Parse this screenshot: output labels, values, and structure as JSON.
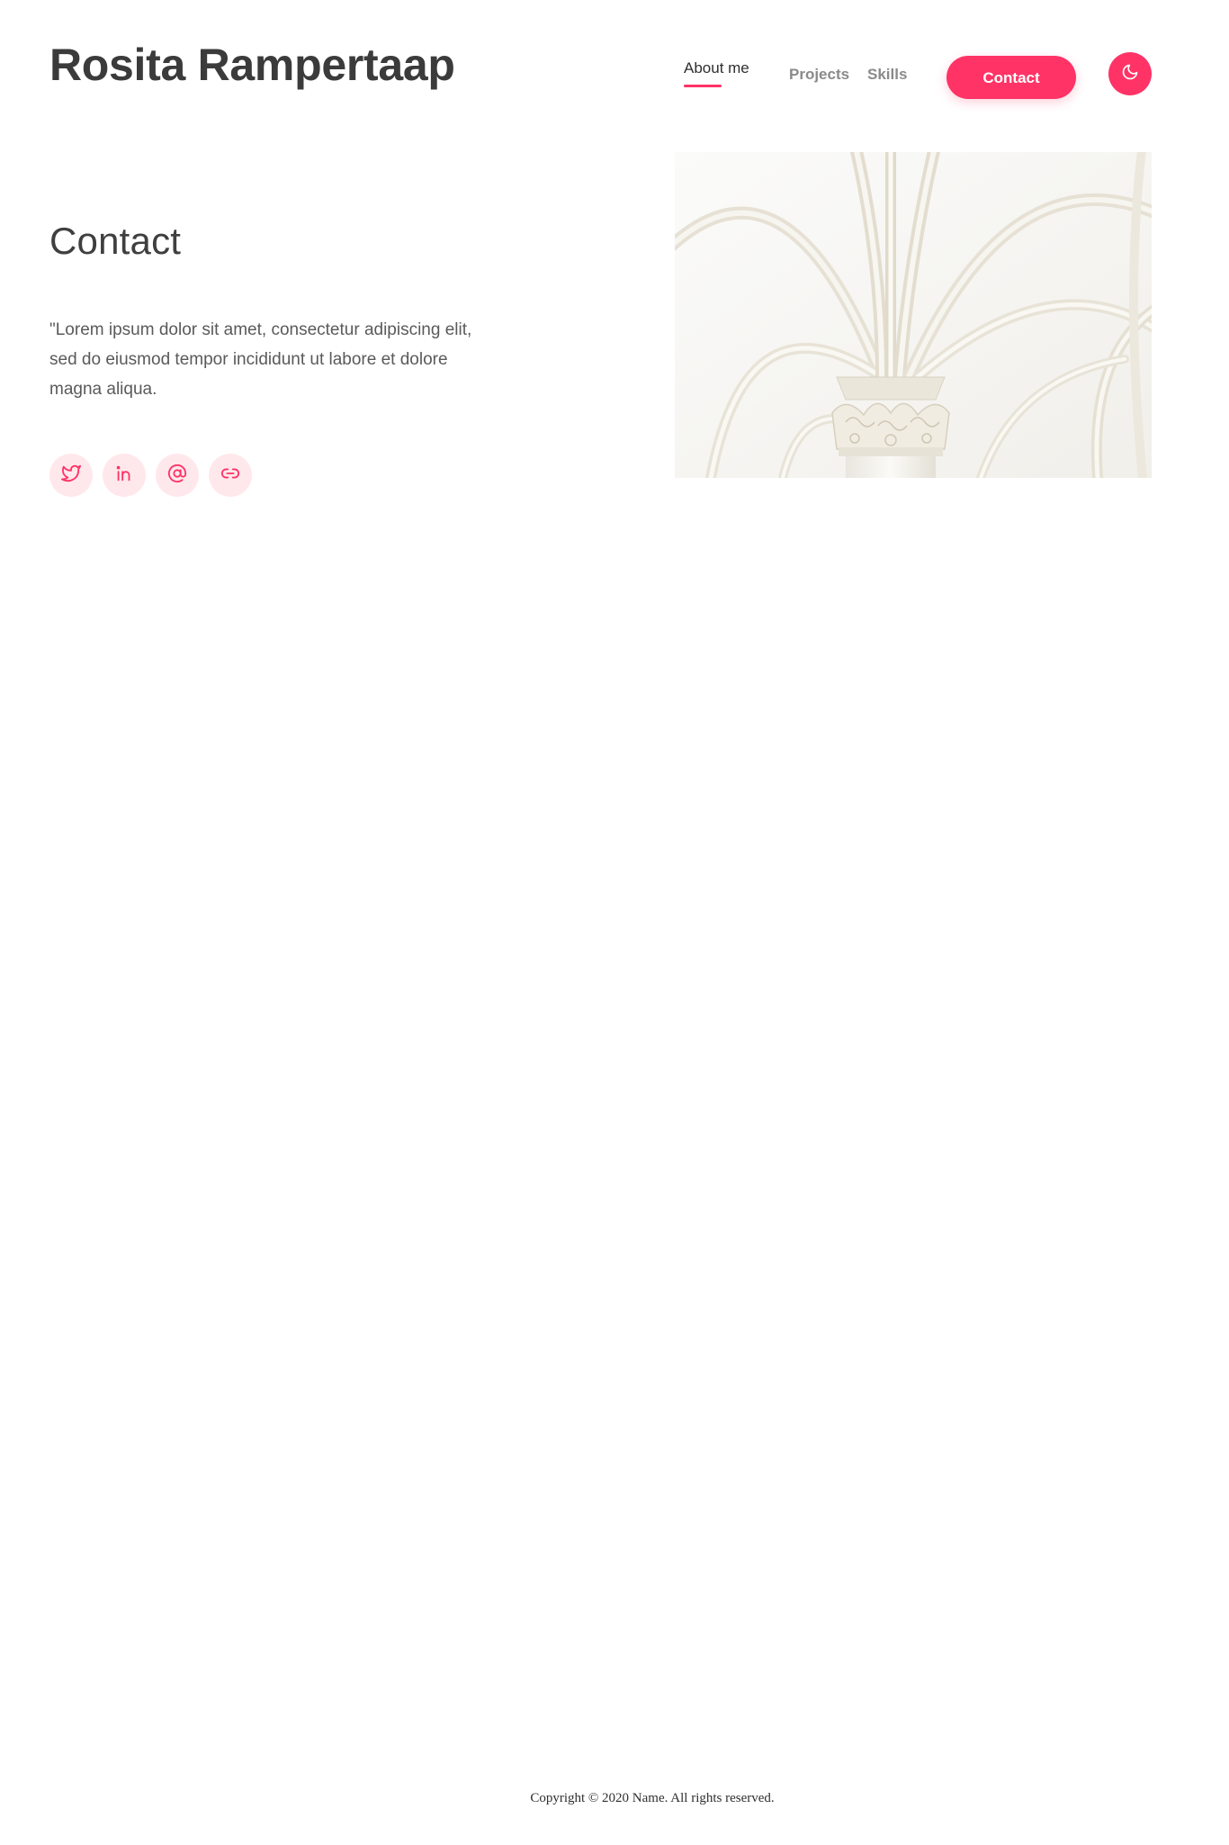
{
  "header": {
    "site_title": "Rosita Rampertaap"
  },
  "nav": {
    "items": [
      {
        "label": "About me",
        "active": true
      },
      {
        "label": "Projects",
        "active": false
      },
      {
        "label": "Skills",
        "active": false
      }
    ],
    "contact_button": "Contact",
    "theme_toggle_icon": "moon-icon"
  },
  "main": {
    "heading": "Contact",
    "text": "\"Lorem ipsum dolor sit amet, consectetur adipiscing elit, sed do eiusmod tempor incididunt ut labore et dolore magna aliqua.",
    "socials": [
      {
        "icon": "twitter-icon"
      },
      {
        "icon": "linkedin-icon"
      },
      {
        "icon": "at-sign-icon"
      },
      {
        "icon": "link-icon"
      }
    ]
  },
  "footer": {
    "copyright": "Copyright © 2020 Name. All rights reserved."
  },
  "colors": {
    "accent": "#ff3366",
    "accent_soft": "#ffe8ec",
    "title": "#3b3b3b",
    "muted_nav": "#8a8a8a"
  }
}
